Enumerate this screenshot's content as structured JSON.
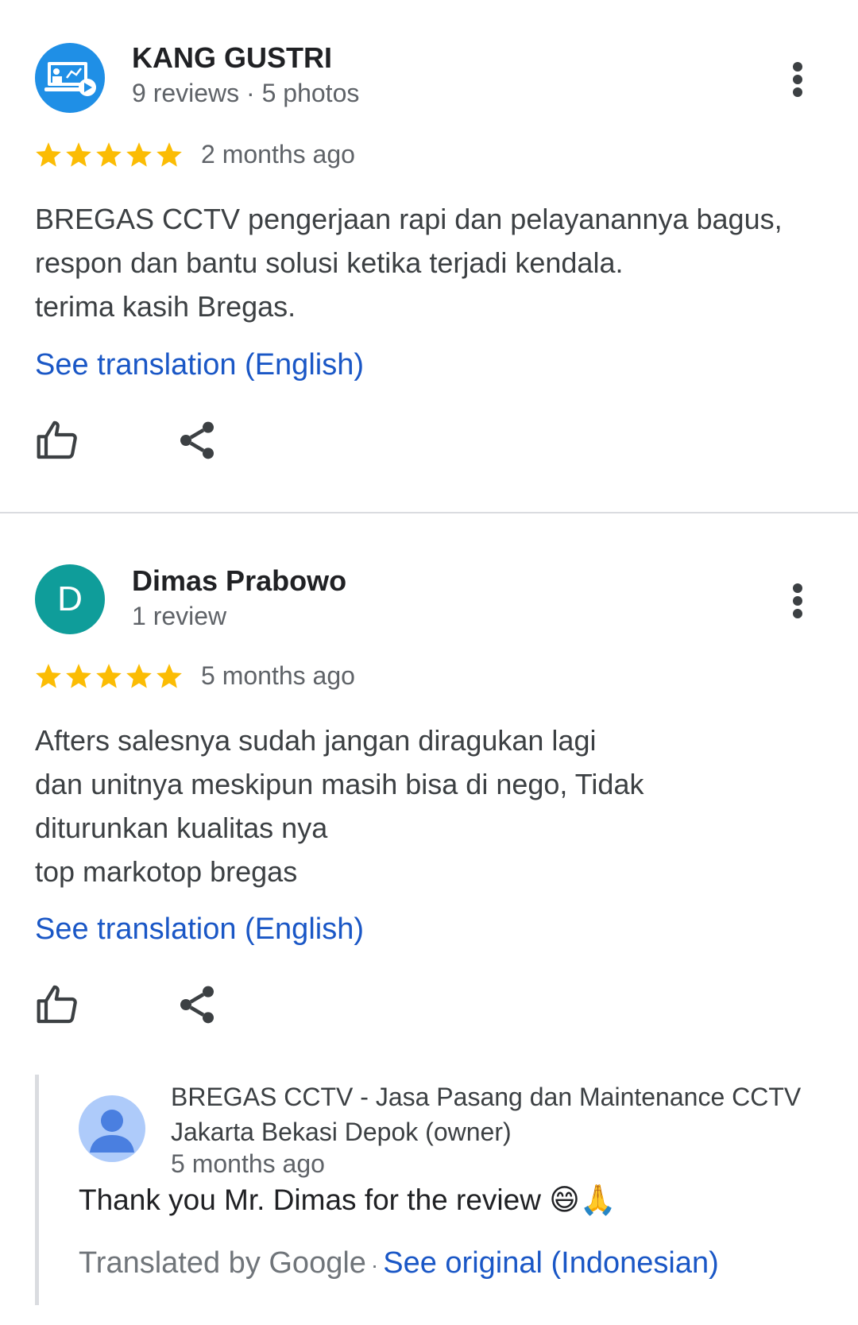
{
  "reviews": [
    {
      "author": "KANG GUSTRI",
      "meta": "9 reviews · 5 photos",
      "avatar_icon": "presentation-screen-icon",
      "rating": 5,
      "time": "2 months ago",
      "text_lines": [
        "BREGAS CCTV pengerjaan rapi dan pelayanannya bagus,",
        "respon dan bantu solusi ketika terjadi kendala.",
        "terima kasih Bregas."
      ],
      "translate_link": "See translation (English)"
    },
    {
      "author": "Dimas Prabowo",
      "meta": "1 review",
      "avatar_letter": "D",
      "rating": 5,
      "time": "5 months ago",
      "text_lines": [
        "Afters salesnya sudah jangan diragukan lagi",
        "dan unitnya meskipun masih bisa di nego, Tidak",
        "diturunkan kualitas nya",
        "top markotop bregas"
      ],
      "translate_link": "See translation (English)",
      "owner_reply": {
        "name_lines": [
          "BREGAS CCTV - Jasa Pasang dan Maintenance CCTV",
          "Jakarta Bekasi Depok (owner)"
        ],
        "time": "5 months ago",
        "text": "Thank you Mr. Dimas for the review 😄🙏",
        "translated_by": "Translated by Google",
        "separator": "·",
        "see_original": "See original (Indonesian)"
      }
    }
  ],
  "colors": {
    "star": "#fbbc04",
    "link": "#1a57c6",
    "avatar_kang": "#1f8fe6",
    "avatar_d": "#0f9d9a",
    "owner_avatar": "#aecbfa",
    "divider": "#dadce0"
  },
  "icons": {
    "more": "more-vertical-icon",
    "like": "thumbs-up-icon",
    "share": "share-icon",
    "star": "star-icon"
  }
}
